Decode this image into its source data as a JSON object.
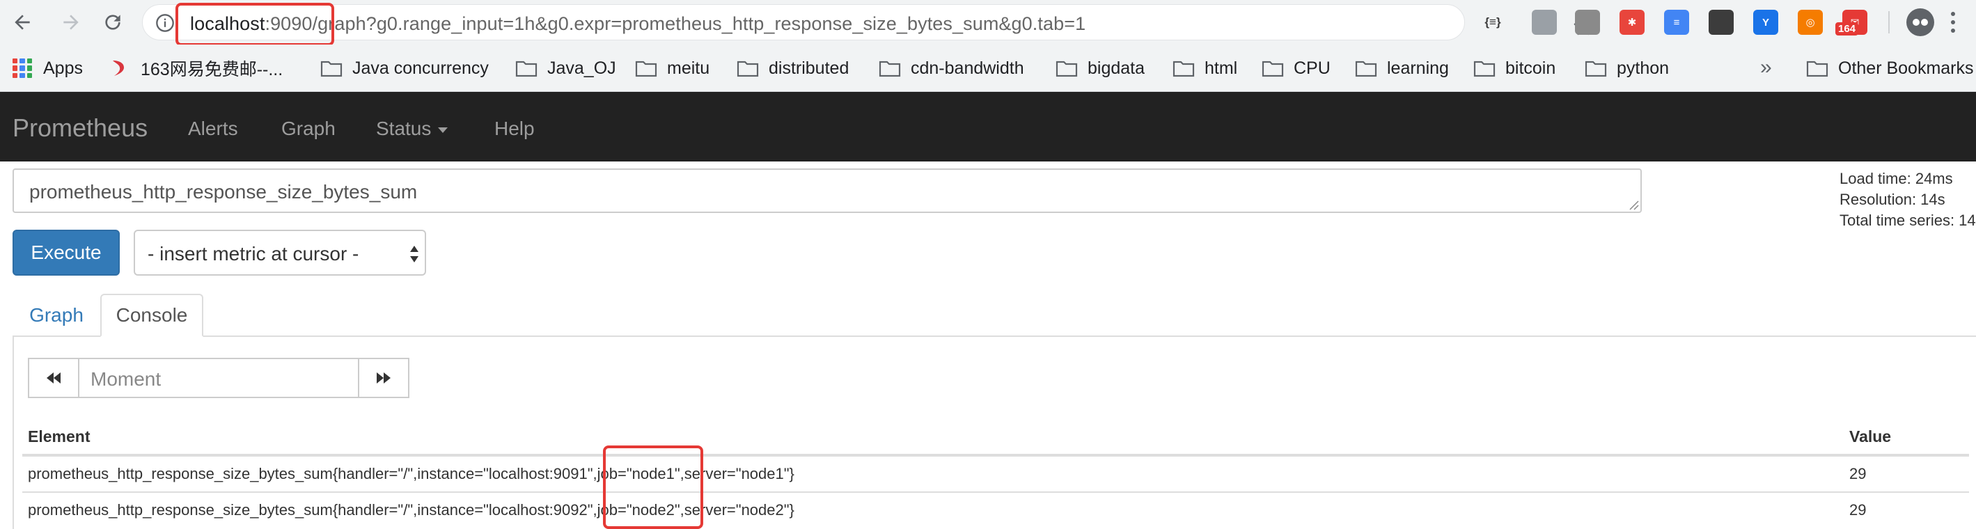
{
  "browser": {
    "url": {
      "host": "localhost",
      "port": ":9090",
      "path": "/graph?g0.range_input=1h&g0.expr=prometheus_http_response_size_bytes_sum&g0.tab=1"
    },
    "extensions": [
      {
        "icon": "json-formatter-icon",
        "glyph": "{≡}",
        "color": "#3c3c3c"
      },
      {
        "icon": "image-frame-icon",
        "glyph": "",
        "color": "#9aa0a6"
      },
      {
        "icon": "globe-icon",
        "glyph": "",
        "color": "#8a8a8a"
      },
      {
        "icon": "pinwheel-icon",
        "glyph": "✱",
        "color": "#e8453c"
      },
      {
        "icon": "database-stack-icon",
        "glyph": "≡",
        "color": "#4285f4"
      },
      {
        "icon": "camera-icon",
        "glyph": "",
        "color": "#3c3c3c"
      },
      {
        "icon": "y-logo-icon",
        "glyph": "Y",
        "color": "#1a73e8"
      },
      {
        "icon": "lifebuoy-icon",
        "glyph": "◎",
        "color": "#f57c00"
      },
      {
        "icon": "mail-164-icon",
        "glyph": "✉",
        "color": "#e53935"
      }
    ],
    "mail_badge": "164",
    "bookmarks": [
      {
        "label": "Apps",
        "icon": "apps-grid-icon"
      },
      {
        "label": "163网易免费邮--...",
        "icon": "netease-mail-icon"
      },
      {
        "label": "Java concurrency",
        "icon": "folder-icon"
      },
      {
        "label": "Java_OJ",
        "icon": "folder-icon"
      },
      {
        "label": "meitu",
        "icon": "folder-icon"
      },
      {
        "label": "distributed",
        "icon": "folder-icon"
      },
      {
        "label": "cdn-bandwidth",
        "icon": "folder-icon"
      },
      {
        "label": "bigdata",
        "icon": "folder-icon"
      },
      {
        "label": "html",
        "icon": "folder-icon"
      },
      {
        "label": "CPU",
        "icon": "folder-icon"
      },
      {
        "label": "learning",
        "icon": "folder-icon"
      },
      {
        "label": "bitcoin",
        "icon": "folder-icon"
      },
      {
        "label": "python",
        "icon": "folder-icon"
      }
    ],
    "overflow_chevron": "»",
    "other_bookmarks": "Other Bookmarks"
  },
  "navbar": {
    "brand": "Prometheus",
    "items": [
      "Alerts",
      "Graph",
      "Status",
      "Help"
    ]
  },
  "query": {
    "expression": "prometheus_http_response_size_bytes_sum",
    "execute_label": "Execute",
    "insert_metric_label": "- insert metric at cursor -"
  },
  "stats": {
    "load_time": "Load time: 24ms",
    "resolution": "Resolution: 14s",
    "total_series": "Total time series: 14"
  },
  "tabs": {
    "graph": "Graph",
    "console": "Console",
    "active": "Console"
  },
  "console": {
    "moment_placeholder": "Moment",
    "columns": [
      "Element",
      "Value"
    ],
    "rows": [
      {
        "element_prefix": "prometheus_http_response_size_bytes_sum{handler=\"/\",instance=\"localhost:9091\"",
        "element_job": ",job=\"node1\"",
        "element_suffix": ",server=\"node1\"}",
        "value": "29"
      },
      {
        "element_prefix": "prometheus_http_response_size_bytes_sum{handler=\"/\",instance=\"localhost:9092\"",
        "element_job": ",job=\"node2\"",
        "element_suffix": ",server=\"node2\"}",
        "value": "29"
      }
    ]
  },
  "colors": {
    "navbar_bg": "#222222",
    "primary_button": "#337ab7",
    "annotation_red": "#e53935"
  }
}
